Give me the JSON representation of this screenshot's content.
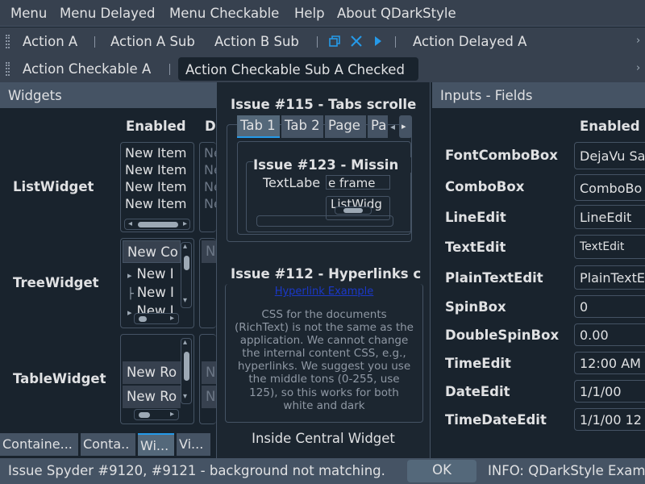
{
  "menubar": {
    "items": [
      "Menu",
      "Menu Delayed",
      "Menu Checkable",
      "Help",
      "About QDarkStyle"
    ]
  },
  "toolbar1": {
    "actions": [
      "Action A",
      "Action A Sub",
      "Action B Sub",
      "Action Delayed A"
    ],
    "icons": [
      "restore-window-icon",
      "close-x-icon",
      "play-arrow-icon"
    ]
  },
  "toolbar2": {
    "actions": [
      "Action Checkable A",
      "Action Checkable Sub A Checked"
    ]
  },
  "widgets_dock": {
    "title": "Widgets",
    "col_enabled": "Enabled",
    "col_disabled": "D",
    "row_list": "ListWidget",
    "row_tree": "TreeWidget",
    "row_table": "TableWidget",
    "list_items": [
      "New Item",
      "New Item",
      "New Item",
      "New Item"
    ],
    "list_items_disabled": [
      "Ne",
      "Ne",
      "Ne",
      "Ne"
    ],
    "tree_header": "New Co",
    "tree_items": [
      "New I",
      "New I",
      "New I"
    ],
    "tree_header_disabled": "N",
    "table_rows": [
      "New Ro",
      "New Ro"
    ],
    "table_rows_disabled": [
      "N",
      "N"
    ]
  },
  "bottom_tabs": [
    "Containe...",
    "Conta..",
    "Wi...",
    "Vi..."
  ],
  "central": {
    "issue115_title": "Issue #115 - Tabs scrolle",
    "tabs": [
      "Tab 1",
      "Tab 2",
      "Page",
      "Pa"
    ],
    "issue123_title": "Issue #123 - Missin",
    "text_label": "TextLabe",
    "frame_label": "e frame",
    "list_widget_label": "ListWidg",
    "issue112_title": "Issue #112 - Hyperlinks c",
    "hyperlink": "Hyperlink Example",
    "css_text": "CSS for the documents (RichText) is not the same as the application. We cannot change the internal content CSS, e.g., hyperlinks. We suggest you use the middle tons (0-255, use 125), so this works for both white and dark",
    "footer": "Inside Central Widget"
  },
  "inputs_dock": {
    "title": "Inputs - Fields",
    "col_enabled": "Enabled",
    "labels": [
      "FontComboBox",
      "ComboBox",
      "LineEdit",
      "TextEdit",
      "PlainTextEdit",
      "SpinBox",
      "DoubleSpinBox",
      "TimeEdit",
      "DateEdit",
      "TimeDateEdit"
    ],
    "values": [
      "DejaVu Sa",
      "ComboBo",
      "LineEdit",
      "TextEdit",
      "PlainTextE",
      "0",
      "0.00",
      "12:00 AM",
      "1/1/00",
      "1/1/00 12"
    ]
  },
  "statusbar": {
    "message": "Issue Spyder #9120, #9121 - background not matching.",
    "ok_label": "OK",
    "info": "INFO: QDarkStyle Exam"
  },
  "colors": {
    "background": "#19232d",
    "panel": "#37414f",
    "border": "#455364",
    "accent": "#259ae9",
    "link": "#1a38c8"
  }
}
